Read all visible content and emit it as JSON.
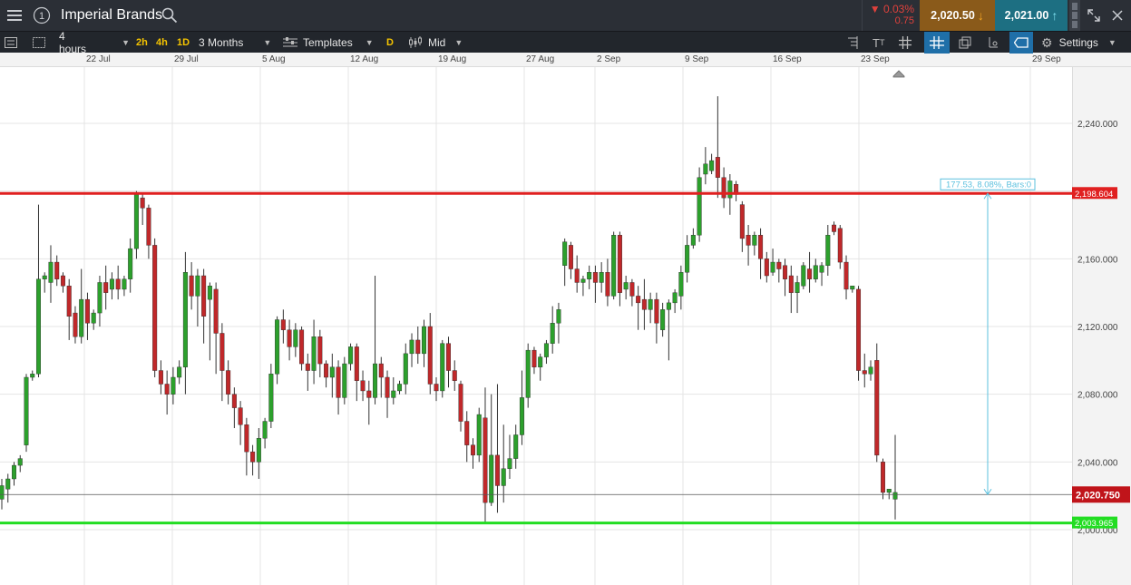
{
  "header": {
    "instrument": "Imperial Brands",
    "change_pct": "▼ 0.03%",
    "change_abs": "0.75",
    "sell_price": "2,020.50",
    "buy_price": "2,021.00",
    "colors": {
      "sell": "#8a5a1a",
      "buy": "#1d6f82",
      "down": "#e0413c"
    }
  },
  "toolbar": {
    "interval": "4 hours",
    "quick_2h": "2h",
    "quick_4h": "4h",
    "quick_1d": "1D",
    "range": "3 Months",
    "templates": "Templates",
    "d_btn": "D",
    "price_type": "Mid",
    "settings": "Settings"
  },
  "chart_data": {
    "type": "candlestick",
    "x_ticks": [
      "22 Jul",
      "29 Jul",
      "5 Aug",
      "12 Aug",
      "19 Aug",
      "27 Aug",
      "2 Sep",
      "9 Sep",
      "16 Sep",
      "23 Sep",
      "29 Sep"
    ],
    "y_ticks": [
      2000,
      2040,
      2080,
      2120,
      2160,
      2200,
      2240
    ],
    "y_tick_labels": [
      "2,000.000",
      "2,040.000",
      "2,080.000",
      "2,120.000",
      "2,160.000",
      "2,200.000",
      "2,240.000"
    ],
    "ylim": [
      1978,
      2266
    ],
    "grid": true,
    "colors": {
      "up": "#2ca02c",
      "down": "#c0282a",
      "resistance": "#e02020",
      "support": "#22dd22",
      "measure": "#5bc0de"
    },
    "resistance_level": 2198.604,
    "resistance_label": "2,198.604",
    "support_level": 2003.965,
    "support_label": "2,003.965",
    "current_level": 2020.75,
    "current_label": "2,020.750",
    "measure_label": "177.53, 8.08%, Bars:0",
    "candles": [
      [
        2018,
        2026,
        2012,
        2030
      ],
      [
        2024,
        2030,
        2016,
        2033
      ],
      [
        2030,
        2038,
        2026,
        2040
      ],
      [
        2038,
        2042,
        2034,
        2044
      ],
      [
        2050,
        2090,
        2046,
        2092
      ],
      [
        2090,
        2092,
        2088,
        2094
      ],
      [
        2092,
        2148,
        2090,
        2192
      ],
      [
        2148,
        2150,
        2140,
        2152
      ],
      [
        2146,
        2158,
        2134,
        2168
      ],
      [
        2158,
        2148,
        2144,
        2162
      ],
      [
        2150,
        2144,
        2140,
        2152
      ],
      [
        2144,
        2126,
        2112,
        2148
      ],
      [
        2128,
        2114,
        2110,
        2132
      ],
      [
        2114,
        2136,
        2110,
        2154
      ],
      [
        2136,
        2122,
        2112,
        2140
      ],
      [
        2122,
        2128,
        2118,
        2130
      ],
      [
        2128,
        2146,
        2120,
        2150
      ],
      [
        2146,
        2140,
        2130,
        2156
      ],
      [
        2142,
        2148,
        2136,
        2152
      ],
      [
        2148,
        2142,
        2136,
        2156
      ],
      [
        2142,
        2148,
        2138,
        2150
      ],
      [
        2148,
        2166,
        2140,
        2172
      ],
      [
        2166,
        2198,
        2160,
        2200
      ],
      [
        2196,
        2190,
        2180,
        2198
      ],
      [
        2190,
        2168,
        2160,
        2192
      ],
      [
        2168,
        2094,
        2090,
        2172
      ],
      [
        2094,
        2086,
        2080,
        2100
      ],
      [
        2086,
        2080,
        2068,
        2094
      ],
      [
        2080,
        2090,
        2074,
        2096
      ],
      [
        2090,
        2096,
        2086,
        2100
      ],
      [
        2096,
        2152,
        2080,
        2164
      ],
      [
        2150,
        2138,
        2130,
        2158
      ],
      [
        2138,
        2150,
        2120,
        2154
      ],
      [
        2150,
        2126,
        2110,
        2154
      ],
      [
        2136,
        2144,
        2100,
        2146
      ],
      [
        2142,
        2116,
        2092,
        2146
      ],
      [
        2116,
        2094,
        2076,
        2122
      ],
      [
        2094,
        2080,
        2074,
        2100
      ],
      [
        2080,
        2072,
        2060,
        2084
      ],
      [
        2072,
        2062,
        2050,
        2076
      ],
      [
        2062,
        2046,
        2032,
        2066
      ],
      [
        2046,
        2040,
        2032,
        2050
      ],
      [
        2040,
        2054,
        2030,
        2060
      ],
      [
        2054,
        2064,
        2048,
        2066
      ],
      [
        2064,
        2092,
        2060,
        2098
      ],
      [
        2092,
        2124,
        2086,
        2126
      ],
      [
        2124,
        2118,
        2110,
        2130
      ],
      [
        2118,
        2108,
        2100,
        2124
      ],
      [
        2108,
        2118,
        2102,
        2122
      ],
      [
        2118,
        2098,
        2094,
        2120
      ],
      [
        2098,
        2094,
        2082,
        2104
      ],
      [
        2094,
        2114,
        2086,
        2124
      ],
      [
        2114,
        2098,
        2090,
        2118
      ],
      [
        2098,
        2090,
        2084,
        2100
      ],
      [
        2090,
        2096,
        2078,
        2104
      ],
      [
        2096,
        2078,
        2068,
        2100
      ],
      [
        2078,
        2098,
        2074,
        2102
      ],
      [
        2098,
        2108,
        2094,
        2110
      ],
      [
        2108,
        2088,
        2076,
        2110
      ],
      [
        2088,
        2082,
        2076,
        2094
      ],
      [
        2082,
        2078,
        2062,
        2088
      ],
      [
        2078,
        2098,
        2074,
        2150
      ],
      [
        2098,
        2090,
        2078,
        2102
      ],
      [
        2090,
        2078,
        2066,
        2094
      ],
      [
        2078,
        2082,
        2074,
        2090
      ],
      [
        2082,
        2086,
        2080,
        2088
      ],
      [
        2086,
        2104,
        2080,
        2110
      ],
      [
        2104,
        2112,
        2096,
        2116
      ],
      [
        2112,
        2104,
        2098,
        2120
      ],
      [
        2104,
        2120,
        2096,
        2124
      ],
      [
        2120,
        2086,
        2080,
        2128
      ],
      [
        2086,
        2082,
        2076,
        2090
      ],
      [
        2082,
        2110,
        2078,
        2112
      ],
      [
        2110,
        2094,
        2084,
        2114
      ],
      [
        2094,
        2088,
        2082,
        2100
      ],
      [
        2086,
        2064,
        2058,
        2088
      ],
      [
        2064,
        2050,
        2040,
        2070
      ],
      [
        2050,
        2044,
        2036,
        2054
      ],
      [
        2044,
        2068,
        2040,
        2072
      ],
      [
        2066,
        2016,
        2004,
        2084
      ],
      [
        2016,
        2044,
        2014,
        2080
      ],
      [
        2044,
        2026,
        2010,
        2086
      ],
      [
        2026,
        2036,
        2016,
        2062
      ],
      [
        2036,
        2042,
        2030,
        2056
      ],
      [
        2042,
        2056,
        2036,
        2062
      ],
      [
        2056,
        2078,
        2050,
        2094
      ],
      [
        2078,
        2106,
        2072,
        2110
      ],
      [
        2106,
        2096,
        2092,
        2108
      ],
      [
        2096,
        2102,
        2088,
        2104
      ],
      [
        2102,
        2110,
        2098,
        2112
      ],
      [
        2110,
        2122,
        2104,
        2132
      ],
      [
        2122,
        2130,
        2110,
        2134
      ],
      [
        2156,
        2170,
        2144,
        2172
      ],
      [
        2168,
        2154,
        2148,
        2170
      ],
      [
        2154,
        2146,
        2140,
        2162
      ],
      [
        2146,
        2148,
        2138,
        2150
      ],
      [
        2148,
        2152,
        2142,
        2156
      ],
      [
        2152,
        2146,
        2134,
        2156
      ],
      [
        2146,
        2152,
        2140,
        2158
      ],
      [
        2152,
        2138,
        2132,
        2160
      ],
      [
        2138,
        2174,
        2136,
        2176
      ],
      [
        2174,
        2140,
        2132,
        2176
      ],
      [
        2142,
        2146,
        2136,
        2150
      ],
      [
        2146,
        2138,
        2132,
        2148
      ],
      [
        2138,
        2134,
        2118,
        2144
      ],
      [
        2136,
        2130,
        2118,
        2148
      ],
      [
        2130,
        2136,
        2122,
        2140
      ],
      [
        2136,
        2122,
        2110,
        2140
      ],
      [
        2118,
        2130,
        2114,
        2134
      ],
      [
        2130,
        2134,
        2100,
        2136
      ],
      [
        2134,
        2140,
        2128,
        2142
      ],
      [
        2138,
        2152,
        2130,
        2156
      ],
      [
        2152,
        2168,
        2146,
        2174
      ],
      [
        2168,
        2174,
        2166,
        2178
      ],
      [
        2174,
        2208,
        2170,
        2214
      ],
      [
        2210,
        2216,
        2204,
        2226
      ],
      [
        2212,
        2218,
        2210,
        2222
      ],
      [
        2220,
        2208,
        2196,
        2256
      ],
      [
        2208,
        2196,
        2190,
        2214
      ],
      [
        2196,
        2206,
        2186,
        2210
      ],
      [
        2204,
        2198,
        2194,
        2206
      ],
      [
        2192,
        2172,
        2164,
        2194
      ],
      [
        2174,
        2168,
        2156,
        2180
      ],
      [
        2168,
        2174,
        2162,
        2176
      ],
      [
        2174,
        2160,
        2148,
        2178
      ],
      [
        2160,
        2150,
        2146,
        2164
      ],
      [
        2152,
        2158,
        2150,
        2166
      ],
      [
        2158,
        2154,
        2146,
        2160
      ],
      [
        2156,
        2148,
        2138,
        2160
      ],
      [
        2150,
        2140,
        2128,
        2156
      ],
      [
        2140,
        2146,
        2128,
        2150
      ],
      [
        2144,
        2156,
        2142,
        2158
      ],
      [
        2154,
        2148,
        2140,
        2164
      ],
      [
        2148,
        2156,
        2146,
        2160
      ],
      [
        2152,
        2156,
        2144,
        2158
      ],
      [
        2156,
        2174,
        2150,
        2180
      ],
      [
        2180,
        2176,
        2174,
        2182
      ],
      [
        2178,
        2158,
        2154,
        2180
      ],
      [
        2158,
        2142,
        2136,
        2162
      ],
      [
        2142,
        2144,
        2140,
        2144
      ],
      [
        2142,
        2094,
        2088,
        2144
      ],
      [
        2094,
        2092,
        2084,
        2104
      ],
      [
        2092,
        2096,
        2088,
        2100
      ],
      [
        2100,
        2044,
        2040,
        2110
      ],
      [
        2040,
        2022,
        2018,
        2042
      ],
      [
        2022,
        2024,
        2018,
        2024
      ],
      [
        2018,
        2022,
        2006,
        2056
      ]
    ]
  }
}
